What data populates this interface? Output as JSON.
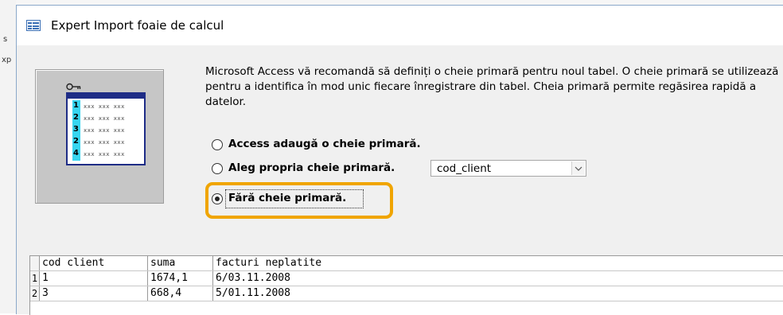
{
  "background": {
    "fragments": [
      "s",
      "xp"
    ]
  },
  "dialog": {
    "title": "Expert Import foaie de calcul",
    "description": "Microsoft Access vă recomandă să definiți o cheie primară pentru noul tabel. O cheie primară se utilizează pentru a identifica în mod unic fiecare înregistrare din tabel. Cheia primară permite regăsirea rapidă a datelor.",
    "illustration": {
      "rows": [
        "1",
        "2",
        "3",
        "2",
        "4"
      ],
      "filler": "xxx xxx xxx"
    },
    "options": [
      {
        "label": "Access adaugă o cheie primară.",
        "selected": false
      },
      {
        "label": "Aleg propria cheie primară.",
        "selected": false
      },
      {
        "label": "Fără cheie primară.",
        "selected": true
      }
    ],
    "combo_value": "cod_client",
    "highlight_color": "#f0a500"
  },
  "preview": {
    "headers": [
      "cod client",
      "suma",
      "facturi neplatite"
    ],
    "rows": [
      {
        "n": "1",
        "cells": [
          "1",
          "1674,1",
          "6/03.11.2008"
        ]
      },
      {
        "n": "2",
        "cells": [
          "3",
          "668,4",
          "5/01.11.2008"
        ]
      }
    ]
  }
}
